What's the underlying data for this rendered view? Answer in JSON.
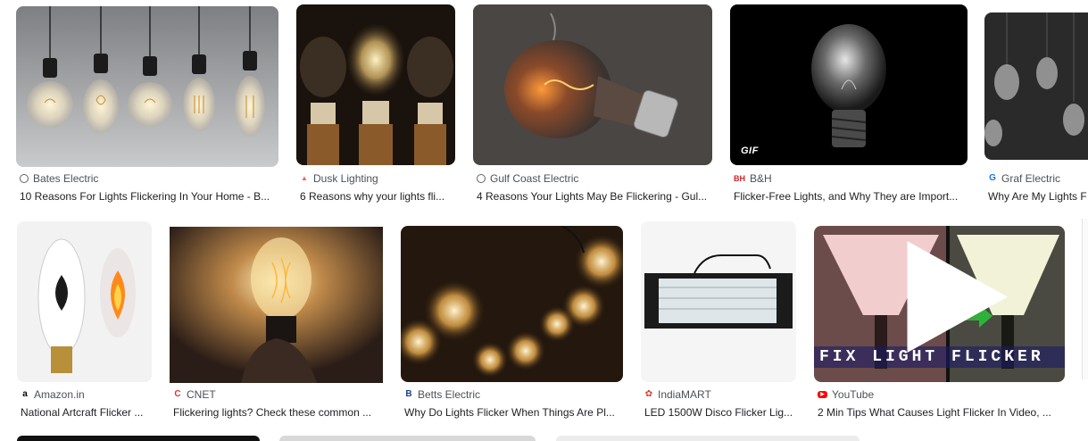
{
  "results": [
    {
      "source": "Bates Electric",
      "title": "10 Reasons For Lights Flickering In Your Home - B...",
      "favicon": "globe-icon",
      "fav_color": "#5f6368"
    },
    {
      "source": "Dusk Lighting",
      "title": "6 Reasons why your lights fli...",
      "favicon": "lamp-icon",
      "fav_color": "#e06b5e"
    },
    {
      "source": "Gulf Coast Electric",
      "title": "4 Reasons Your Lights May Be Flickering - Gul...",
      "favicon": "globe-icon",
      "fav_color": "#5f6368"
    },
    {
      "source": "B&H",
      "title": "Flicker-Free Lights, and Why They are Import...",
      "favicon": "bh-logo-icon",
      "fav_color": "#d3222a",
      "badge": "GIF"
    },
    {
      "source": "Graf Electric",
      "title": "Why Are My Lights F",
      "favicon": "graf-logo-icon",
      "fav_color": "#1a73e8"
    },
    {
      "source": "Amazon.in",
      "title": "National Artcraft Flicker ...",
      "favicon": "amazon-logo-icon",
      "fav_color": "#000000"
    },
    {
      "source": "CNET",
      "title": "Flickering lights? Check these common ...",
      "favicon": "cnet-logo-icon",
      "fav_color": "#e5322d"
    },
    {
      "source": "Betts Electric",
      "title": "Why Do Lights Flicker When Things Are Pl...",
      "favicon": "betts-logo-icon",
      "fav_color": "#1a3d8f"
    },
    {
      "source": "IndiaMART",
      "title": "LED 1500W Disco Flicker Lig...",
      "favicon": "indiamart-logo-icon",
      "fav_color": "#d43c2c"
    },
    {
      "source": "YouTube",
      "title": "2 Min Tips What Causes Light Flicker In Video, ...",
      "favicon": "youtube-logo-icon",
      "fav_color": "#ff0000",
      "overlay_text": "FIX LIGHT FLICKER"
    }
  ]
}
